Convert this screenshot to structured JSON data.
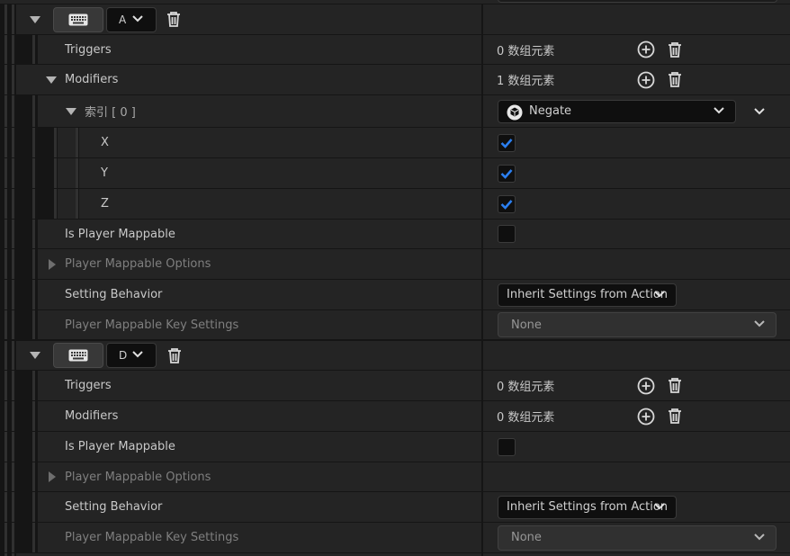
{
  "mappings": [
    {
      "key_label": "A",
      "keyboard_icon": "keyboard-icon",
      "rows": {
        "triggers": {
          "label": "Triggers",
          "value": "0 数组元素"
        },
        "modifiers": {
          "label": "Modifiers",
          "value": "1 数组元素"
        },
        "index": {
          "label": "索引 [ 0 ]",
          "modifier_value": "Negate"
        },
        "axes": [
          {
            "label": "X",
            "checked": true
          },
          {
            "label": "Y",
            "checked": true
          },
          {
            "label": "Z",
            "checked": true
          }
        ],
        "is_player_mappable": {
          "label": "Is Player Mappable",
          "checked": false
        },
        "player_mappable_options": {
          "label": "Player Mappable Options"
        },
        "setting_behavior": {
          "label": "Setting Behavior",
          "value": "Inherit Settings from Action"
        },
        "key_settings": {
          "label": "Player Mappable Key Settings",
          "value": "None"
        }
      }
    },
    {
      "key_label": "D",
      "keyboard_icon": "keyboard-icon",
      "rows": {
        "triggers": {
          "label": "Triggers",
          "value": "0 数组元素"
        },
        "modifiers": {
          "label": "Modifiers",
          "value": "0 数组元素"
        },
        "is_player_mappable": {
          "label": "Is Player Mappable",
          "checked": false
        },
        "player_mappable_options": {
          "label": "Player Mappable Options"
        },
        "setting_behavior": {
          "label": "Setting Behavior",
          "value": "Inherit Settings from Action"
        },
        "key_settings": {
          "label": "Player Mappable Key Settings",
          "value": "None"
        }
      }
    }
  ],
  "colors": {
    "panel": "#242424",
    "background": "#151515",
    "checkbox_accent": "#2b7ff0"
  }
}
